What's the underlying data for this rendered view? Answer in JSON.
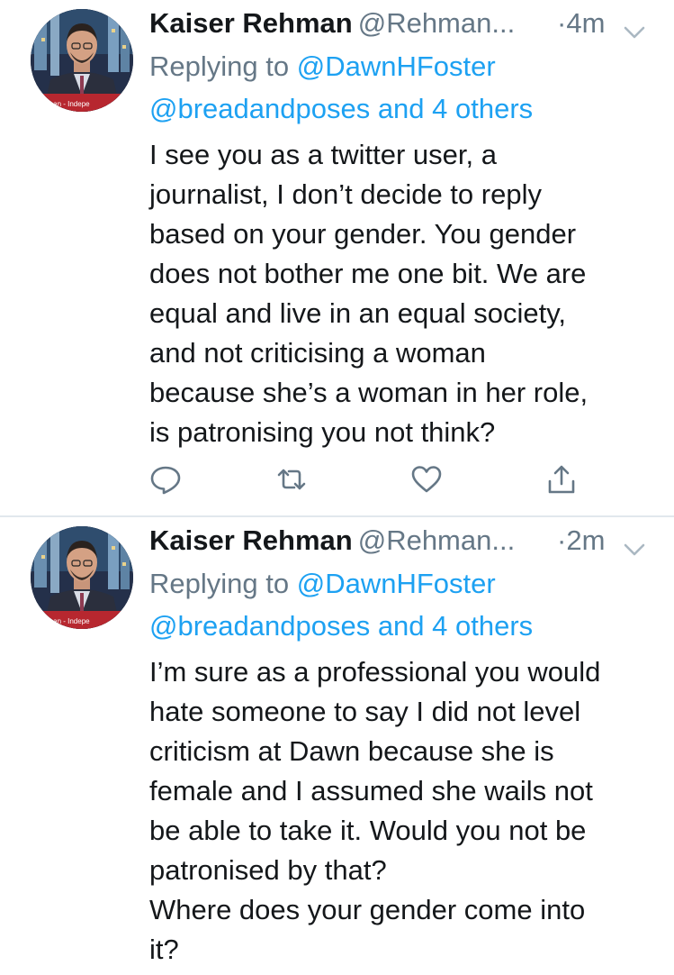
{
  "tweets": [
    {
      "author_name": "Kaiser Rehman",
      "author_handle": "@Rehman...",
      "time": "·4m",
      "reply_prefix": "Replying to",
      "reply_mention": "@DawnHFoster",
      "reply_line2": "@breadandposes and 4 others",
      "avatar_caption": "hman - Indepe",
      "text_lines": [
        "I see you as a twitter user, a",
        "journalist, I don’t decide to reply",
        "based on your gender. You gender",
        "does not bother me one bit. We are",
        "equal and live in an equal society,",
        "and not criticising a woman",
        "because she’s a woman in her role,",
        "is patronising you not think?"
      ]
    },
    {
      "author_name": "Kaiser Rehman",
      "author_handle": "@Rehman...",
      "time": "·2m",
      "reply_prefix": "Replying to",
      "reply_mention": "@DawnHFoster",
      "reply_line2": "@breadandposes and 4 others",
      "avatar_caption": "hman - Indepe",
      "text_lines": [
        "I’m sure as a professional you would",
        "hate someone to say I did not level",
        "criticism at Dawn because she is",
        "female and I assumed she wails not",
        "be able to take it. Would you not be",
        "patronised by that?",
        "Where does your gender come into",
        "it?"
      ]
    }
  ],
  "icons": {
    "reply": "reply-icon",
    "retweet": "retweet-icon",
    "like": "heart-icon",
    "share": "share-icon",
    "menu": "chevron-down-icon"
  },
  "colors": {
    "text": "#14171a",
    "secondary": "#657786",
    "link": "#1da1f2",
    "divider": "#e1e8ed"
  }
}
